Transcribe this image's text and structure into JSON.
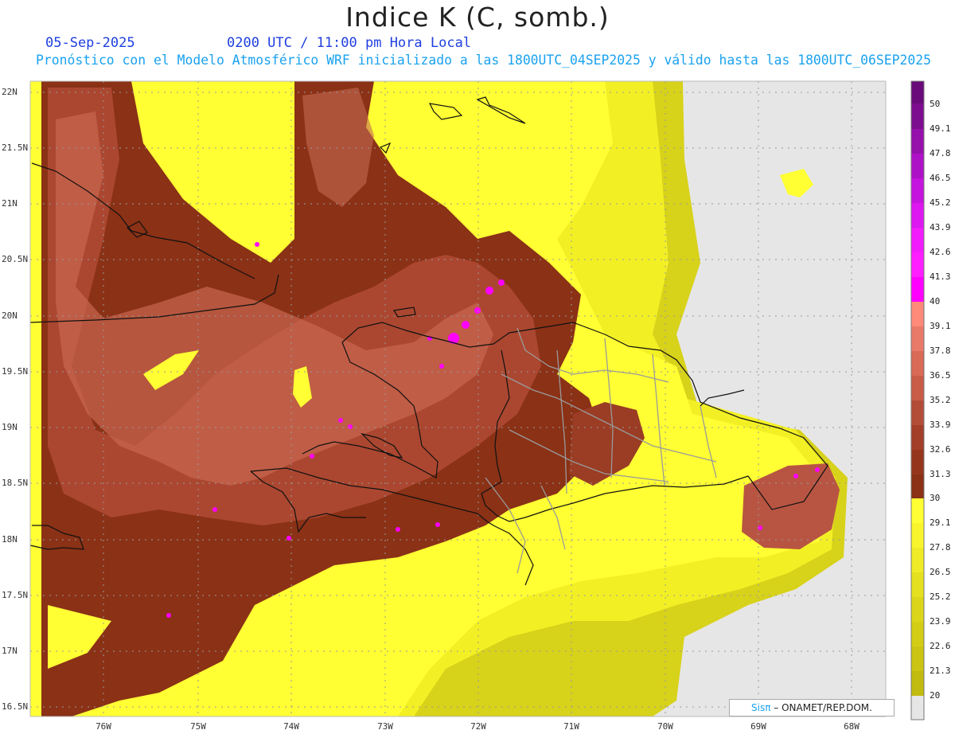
{
  "header": {
    "title": "Indice K (C, somb.)",
    "date": "05-Sep-2025",
    "time": "0200 UTC / 11:00 pm Hora Local",
    "model_line": "Pronóstico con el Modelo Atmosférico WRF inicializado a las 1800UTC_04SEP2025 y válido hasta las  1800UTC_06SEP2025"
  },
  "map": {
    "lat_labels": [
      "22N",
      "21.5N",
      "21N",
      "20.5N",
      "20N",
      "19.5N",
      "19N",
      "18.5N",
      "18N",
      "17.5N",
      "17N",
      "16.5N"
    ],
    "lon_labels": [
      "76W",
      "75W",
      "74W",
      "73W",
      "72W",
      "71W",
      "70W",
      "69W",
      "68W"
    ]
  },
  "colorbar": {
    "levels": [
      "50",
      "49.1",
      "47.8",
      "46.5",
      "45.2",
      "43.9",
      "42.6",
      "41.3",
      "40",
      "39.1",
      "37.8",
      "36.5",
      "35.2",
      "33.9",
      "32.6",
      "31.3",
      "30",
      "29.1",
      "27.8",
      "26.5",
      "25.2",
      "23.9",
      "22.6",
      "21.3",
      "20"
    ],
    "colors": {
      "violet_top": "#6a0a7a",
      "magenta": "#ff00ff",
      "salmon": "#ff8a7a",
      "brown_mid": "#b85542",
      "brown_dark": "#8a3116",
      "yellow": "#ffff33",
      "olive_low": "#c8c010",
      "gray_min": "#e6e6e6"
    }
  },
  "credit": {
    "sis": "Sisπ",
    "org": " – ONAMET/REP.DOM."
  }
}
